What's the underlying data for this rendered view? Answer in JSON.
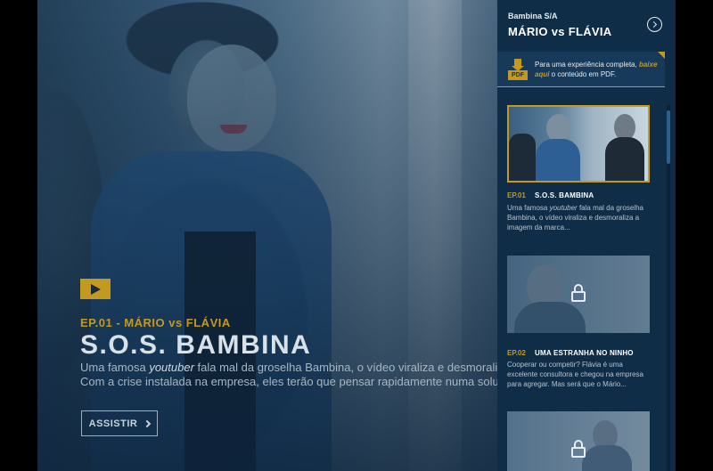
{
  "hero": {
    "episode_label": "EP.01 - MÁRIO vs FLÁVIA",
    "title": "S.O.S. BAMBINA",
    "description_lead": "Uma famosa ",
    "description_em": "youtuber",
    "description_rest": " fala mal da groselha Bambina, o vídeo viraliza e desmoraliza a",
    "description_line2": "Com a crise instalada na empresa, eles terão que pensar rapidamente numa solução p",
    "watch_label": "ASSISTIR",
    "play_icon": "play-icon"
  },
  "sidebar": {
    "brand": "Bambina S/A",
    "title": "MÁRIO vs FLÁVIA",
    "next_icon": "chevron-right-circle-icon",
    "pdf": {
      "icon_label": "PDF",
      "text_lead": "Para uma experiência completa, ",
      "text_link": "baixe aqui",
      "text_rest": " o conteúdo em PDF."
    },
    "episodes": [
      {
        "number": "EP.01",
        "name": "S.O.S. BAMBINA",
        "desc_lead": "Uma famosa ",
        "desc_em": "youtuber",
        "desc_rest": " fala mal da groselha Bambina, o vídeo viraliza e desmoraliza a imagem da marca...",
        "locked": false
      },
      {
        "number": "EP.02",
        "name": "UMA ESTRANHA NO NINHO",
        "desc_lead": "Cooperar ou competir? Flávia é uma excelente consultora e chegou na empresa para agregar. Mas será que o Mário...",
        "desc_em": "",
        "desc_rest": "",
        "locked": true
      },
      {
        "number": "",
        "name": "",
        "desc_lead": "",
        "desc_em": "",
        "desc_rest": "",
        "locked": true
      }
    ]
  },
  "colors": {
    "accent": "#c39a1f",
    "sidebar_bg": "#0f2d47",
    "text_light": "#e6ecf1"
  }
}
